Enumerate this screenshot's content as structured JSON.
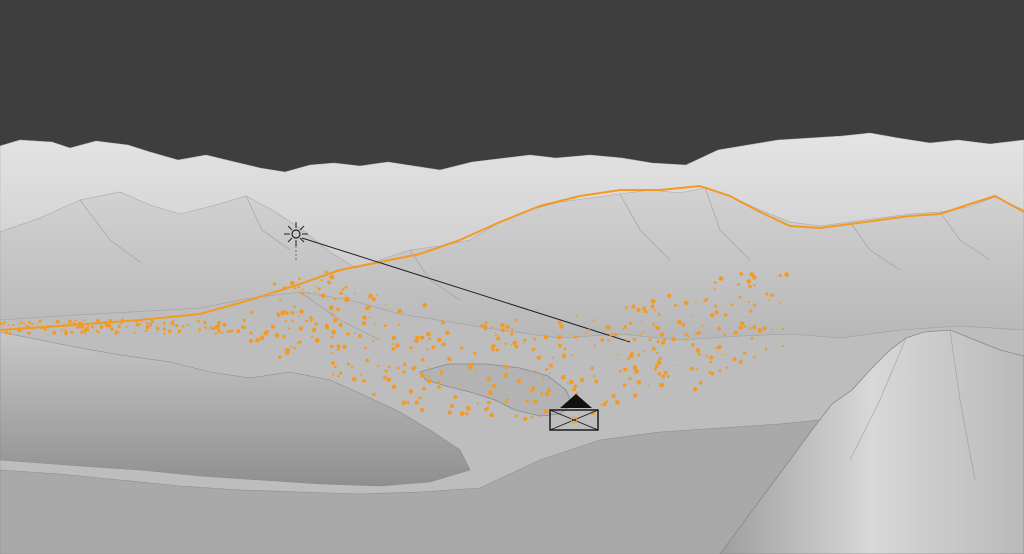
{
  "viewport": {
    "background_color": "#3d3d3d",
    "terrain_colors": {
      "far": "#d9d9d9",
      "mid": "#c4c4c4",
      "near": "#b0b0b0",
      "shadow": "#8e8e8e",
      "lake": "#aeaeae"
    },
    "selection_color": "#f39a25"
  },
  "scene_objects": {
    "sun_lamp": {
      "type": "light",
      "icon": "sun-lamp-icon"
    },
    "camera": {
      "type": "camera",
      "icon": "camera-icon",
      "active": true
    },
    "selected_path": {
      "type": "curve",
      "icon": "orange-curve-path",
      "selected": true
    },
    "point_cloud": {
      "type": "particles",
      "icon": "orange-particle-points",
      "selected": true
    }
  }
}
